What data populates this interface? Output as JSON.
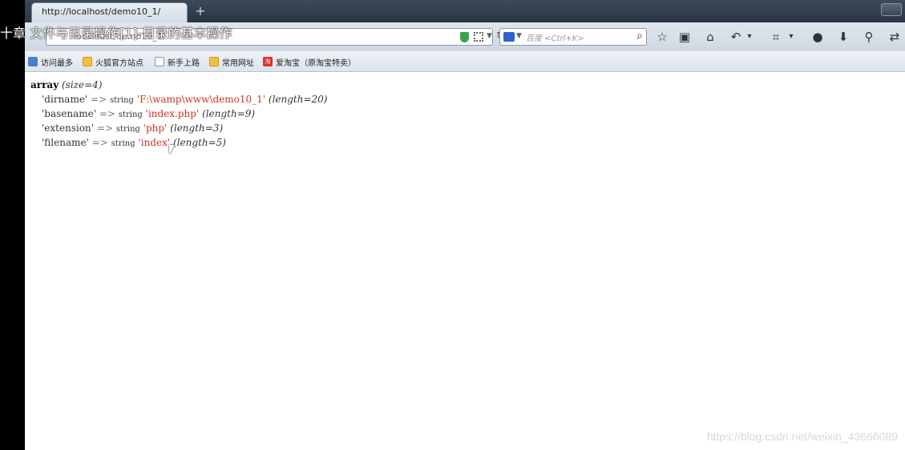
{
  "caption": "十章 文件与目录操作[1]-目录的基本操作",
  "tab": {
    "title": "http://localhost/demo10_1/",
    "new_tab_label": "+"
  },
  "urlbar": {
    "value": "localhost/demo10_1/",
    "shield_icon": "shield-icon",
    "reload_symbol": "↻"
  },
  "searchbar": {
    "placeholder": "百度 <Ctrl+K>",
    "icon": "⌕"
  },
  "toolbar": [
    "☆",
    "▣",
    "⌂",
    "↶",
    "▾",
    "⌗",
    "▾",
    "●",
    "⬇",
    "⚲",
    "⇄"
  ],
  "bookmarks": [
    {
      "label": "访问最多",
      "icon": "visited"
    },
    {
      "label": "火狐官方站点",
      "icon": "folder"
    },
    {
      "label": "新手上路",
      "icon": "page"
    },
    {
      "label": "常用网址",
      "icon": "folder"
    },
    {
      "label": "爱淘宝（原淘宝特卖）",
      "icon": "taobao",
      "icon_text": "淘"
    }
  ],
  "dump": {
    "header_kw": "array",
    "header_meta": "(size=4)",
    "arrow": "=>",
    "type": "string",
    "rows": [
      {
        "key": "'dirname'",
        "value": "'F:\\wamp\\www\\demo10_1'",
        "meta": "(length=20)"
      },
      {
        "key": "'basename'",
        "value": "'index.php'",
        "meta": "(length=9)"
      },
      {
        "key": "'extension'",
        "value": "'php'",
        "meta": "(length=3)"
      },
      {
        "key": "'filename'",
        "value": "'index'",
        "meta": "(length=5)"
      }
    ]
  },
  "watermark": "https://blog.csdn.net/weixin_43666089"
}
